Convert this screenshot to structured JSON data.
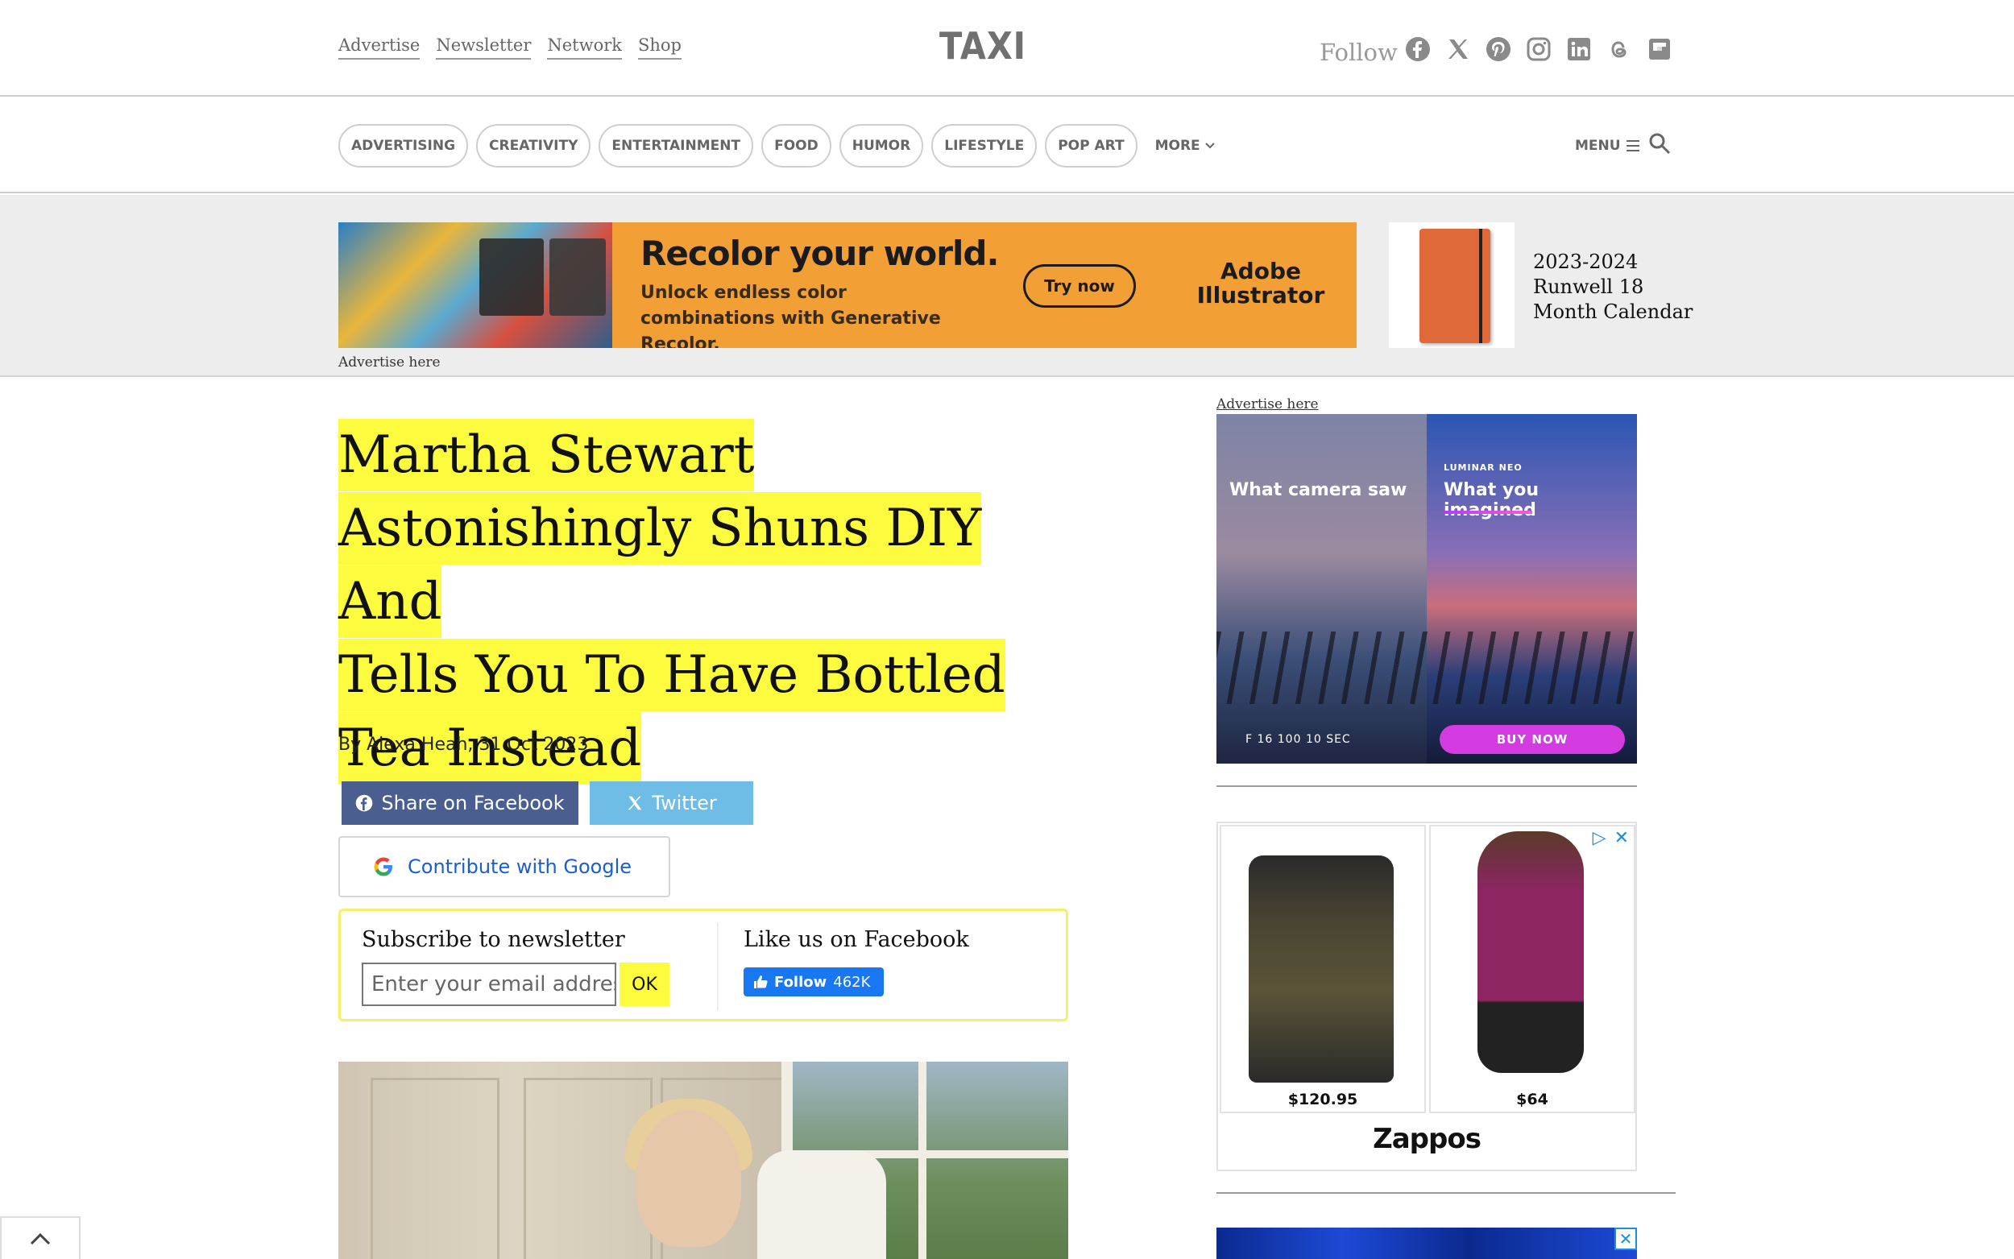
{
  "top_links": [
    "Advertise",
    "Newsletter",
    "Network",
    "Shop"
  ],
  "logo": "TAXI",
  "follow_label": "Follow",
  "social_icons": [
    "facebook-icon",
    "x-icon",
    "pinterest-icon",
    "instagram-icon",
    "linkedin-icon",
    "threads-icon",
    "flipboard-icon"
  ],
  "nav": {
    "categories": [
      "ADVERTISING",
      "CREATIVITY",
      "ENTERTAINMENT",
      "FOOD",
      "HUMOR",
      "LIFESTYLE",
      "POP ART"
    ],
    "more_label": "MORE",
    "menu_label": "MENU"
  },
  "banner_ad": {
    "headline": "Recolor your world.",
    "sub": "Unlock endless color combinations with Generative Recolor.",
    "cta": "Try now",
    "brand": "Adobe Illustrator"
  },
  "advertise_here_label": "Advertise here",
  "calendar_ad": {
    "text_line1": "2023-2024",
    "text_line2": "Runwell 18",
    "text_line3": "Month Calendar"
  },
  "article": {
    "title_lines": [
      "Martha Stewart",
      "Astonishingly Shuns DIY And",
      "Tells You To Have Bottled",
      "Tea Instead"
    ],
    "byline": "By Alexa Heah, 31 Oct 2023",
    "share_facebook": "Share on Facebook",
    "share_twitter": "Twitter",
    "contribute": "Contribute with Google"
  },
  "subscribe": {
    "title": "Subscribe to newsletter",
    "email_placeholder": "Enter your email address",
    "ok": "OK",
    "like_title": "Like us on Facebook",
    "follow_label": "Follow",
    "follow_count": "462K"
  },
  "sidebar": {
    "advertise_here": "Advertise here",
    "luminar": {
      "left_caption": "What camera saw",
      "brand": "LUMINAR NEO",
      "right_caption": "What you imagined",
      "buy": "BUY NOW",
      "meta": "F 16    100    10 SEC"
    },
    "zappos": {
      "price1": "$120.95",
      "price2": "$64",
      "logo": "Zappos"
    }
  }
}
